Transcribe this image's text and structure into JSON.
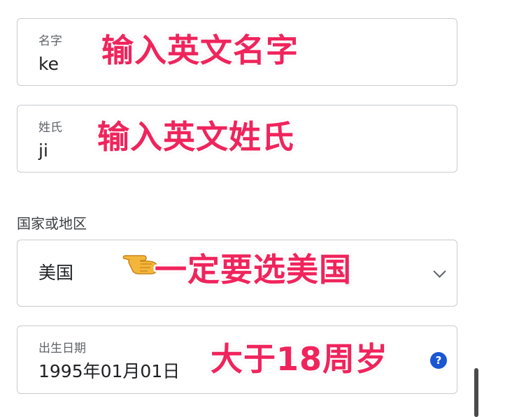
{
  "first_name": {
    "label": "名字",
    "value": "ke",
    "annotation": "输入英文名字"
  },
  "last_name": {
    "label": "姓氏",
    "value": "ji",
    "annotation": "输入英文姓氏"
  },
  "country": {
    "section_label": "国家或地区",
    "value": "美国",
    "annotation": "一定要选美国",
    "icon": "pointing-hand-icon"
  },
  "birthday": {
    "label": "出生日期",
    "value": "1995年01月01日",
    "annotation": "大于18周岁",
    "help_icon_text": "?"
  },
  "colors": {
    "annotation": "#f0245c",
    "accent": "#1a57d3",
    "border": "#c8cbcf"
  }
}
